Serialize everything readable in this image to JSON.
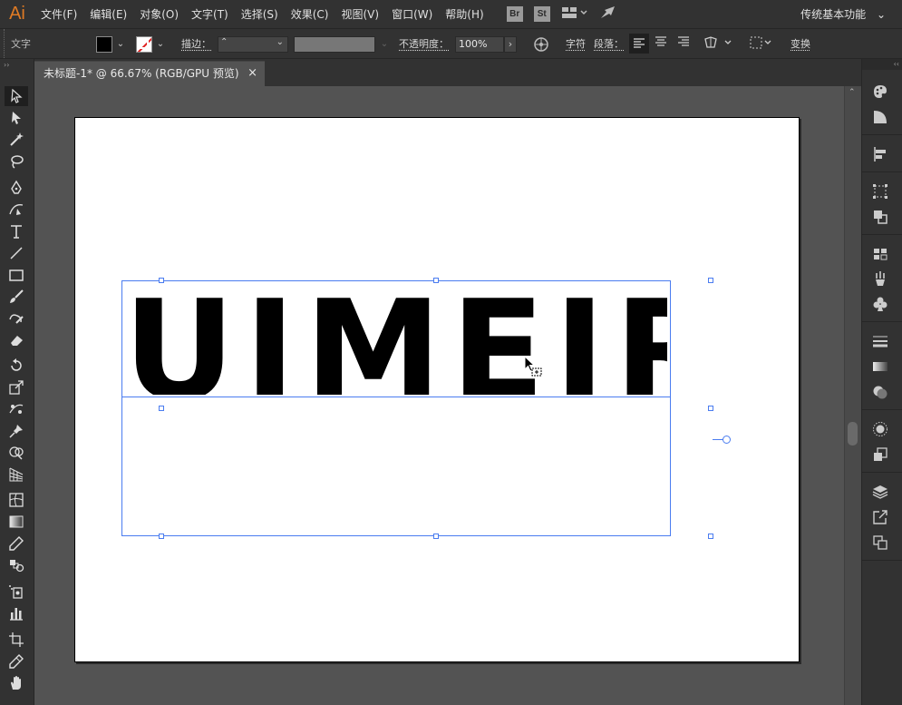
{
  "app": {
    "logo": "Ai"
  },
  "menu": {
    "items": [
      "文件(F)",
      "编辑(E)",
      "对象(O)",
      "文字(T)",
      "选择(S)",
      "效果(C)",
      "视图(V)",
      "窗口(W)",
      "帮助(H)"
    ],
    "bridge": "Br",
    "stock": "St",
    "workspace": "传统基本功能",
    "workspace_caret": "⌄"
  },
  "control": {
    "tool_label": "文字",
    "stroke_label": "描边：",
    "opacity_label": "不透明度：",
    "opacity_value": "100%",
    "char_label": "字符",
    "para_label": "段落：",
    "transform_label": "变换",
    "fill_color": "#000000",
    "caret": "⌄",
    "stepper": "⌃",
    "next": "›"
  },
  "tabs": {
    "doc_title": "未标题-1* @ 66.67% (RGB/GPU 预览)",
    "close": "×"
  },
  "canvas": {
    "text": "UIMEIR",
    "selection_color": "#4a7cf0"
  },
  "scroll": {
    "up": "⌃"
  },
  "grips": {
    "left": "››",
    "right": "‹‹"
  }
}
